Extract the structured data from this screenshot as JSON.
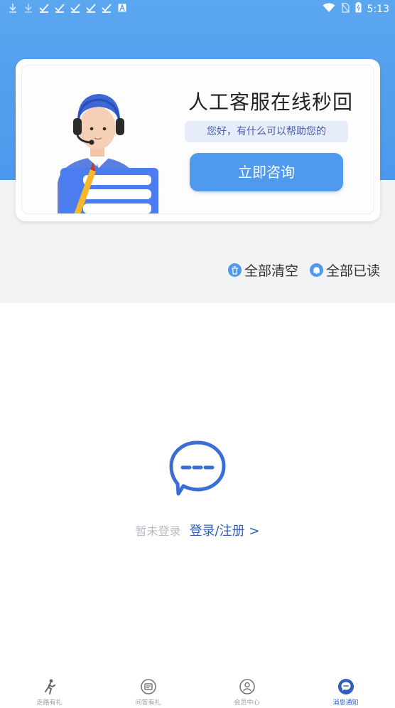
{
  "status_bar": {
    "time": "5:13",
    "left_icons": [
      "download-icon",
      "download-icon",
      "check-icon",
      "check-icon",
      "check-icon",
      "check-icon",
      "check-icon",
      "a-box-icon"
    ],
    "right_icons": [
      "wifi-icon",
      "sim-off-icon",
      "battery-icon"
    ]
  },
  "banner": {
    "title": "人工客服在线秒回",
    "subtitle": "您好，有什么可以帮助您的",
    "button": "立即咨询"
  },
  "actions": {
    "clear_all": "全部清空",
    "read_all": "全部已读"
  },
  "empty_state": {
    "not_logged_in": "暂未登录",
    "login_link": "登录/注册 >"
  },
  "tabs": [
    {
      "label": "走路有礼",
      "icon": "running-person-icon",
      "active": false
    },
    {
      "label": "问答有礼",
      "icon": "quiz-icon",
      "active": false
    },
    {
      "label": "会员中心",
      "icon": "member-icon",
      "active": false
    },
    {
      "label": "消息通知",
      "icon": "message-icon",
      "active": true
    }
  ],
  "colors": {
    "header_blue": "#4c98ec",
    "button_blue": "#4f9aec",
    "link_blue": "#2f5fb8",
    "gray_bg": "#f2f3f5"
  }
}
